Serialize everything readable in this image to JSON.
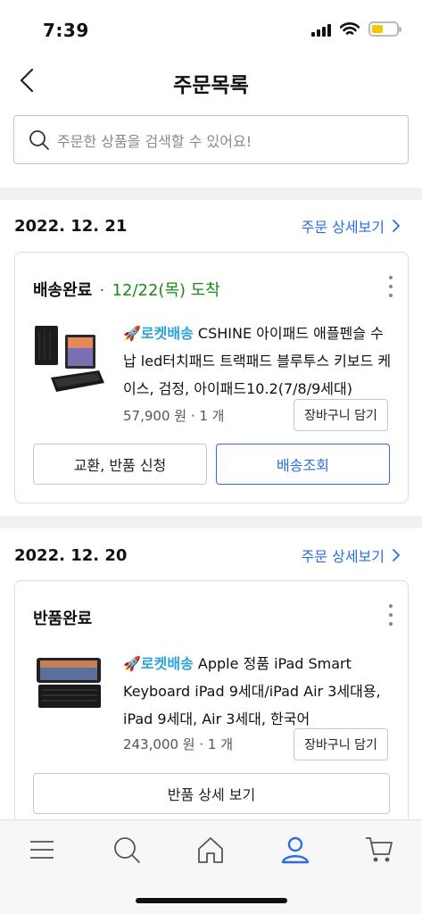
{
  "status_bar": {
    "time": "7:39"
  },
  "header": {
    "title": "주문목록"
  },
  "search": {
    "placeholder": "주문한 상품을 검색할 수 있어요!"
  },
  "orders": [
    {
      "date": "2022. 12. 21",
      "detail_link": "주문 상세보기",
      "status": "배송완료",
      "status_separator": "·",
      "arrival": "12/22(목) 도착",
      "delivery_tag": "로켓배송",
      "product_name": "CSHINE 아이패드 애플펜슬 수납 led터치패드 트랙패드 블루투스 키보드 케이스, 검정, 아이패드10.2(7/8/9세대)",
      "price": "57,900 원 · 1 개",
      "cart_button": "장바구니 담기",
      "buttons": [
        "교환, 반품 신청",
        "배송조회"
      ]
    },
    {
      "date": "2022. 12. 20",
      "detail_link": "주문 상세보기",
      "status": "반품완료",
      "delivery_tag": "로켓배송",
      "product_name": "Apple 정품 iPad Smart Keyboard iPad 9세대/iPad Air 3세대용, iPad 9세대, Air 3세대, 한국어",
      "price": "243,000 원 · 1 개",
      "cart_button": "장바구니 담기",
      "buttons": [
        "반품 상세 보기"
      ]
    }
  ],
  "bottom_nav": {
    "items": [
      "menu-icon",
      "search-icon",
      "home-icon",
      "user-icon",
      "cart-icon"
    ],
    "active": "user-icon"
  },
  "colors": {
    "link": "#2b6ee0",
    "arrival": "#1a8a1a",
    "rocket": "#2aa3d6",
    "active_nav": "#2b6ee0"
  }
}
